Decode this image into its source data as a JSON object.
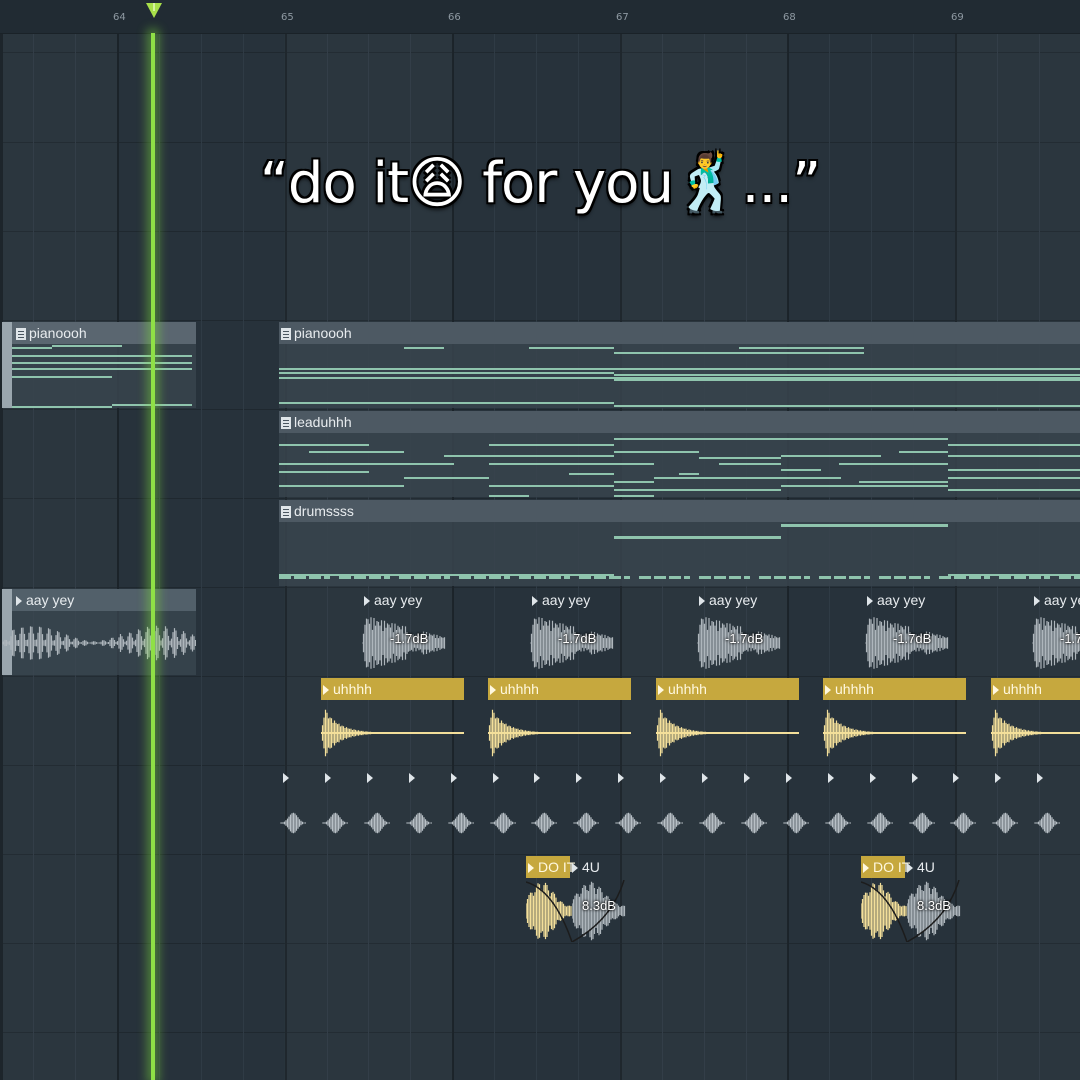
{
  "caption": "“do it😩 for you🕺...”",
  "ruler": {
    "bars": [
      {
        "label": "64"
      },
      {
        "label": "65"
      },
      {
        "label": "66"
      },
      {
        "label": "67"
      },
      {
        "label": "68"
      },
      {
        "label": "69"
      }
    ]
  },
  "tracks": {
    "piano": {
      "name": "pianoooh"
    },
    "lead": {
      "name": "leaduhhh"
    },
    "drums": {
      "name": "drumssss"
    },
    "vocal": {
      "name": "aay yey",
      "gain": "-1.7dB"
    },
    "uhhh": {
      "name": "uhhhh"
    },
    "doit": {
      "name": "DO IT",
      "name2": "4U",
      "gain": "8.3dB"
    }
  },
  "colors": {
    "background": "#27323b",
    "playhead": "#8fe046",
    "note": "#8fc4ad",
    "uhhh_clip": "#c6a83e",
    "waveform": "#aeb6bc"
  }
}
